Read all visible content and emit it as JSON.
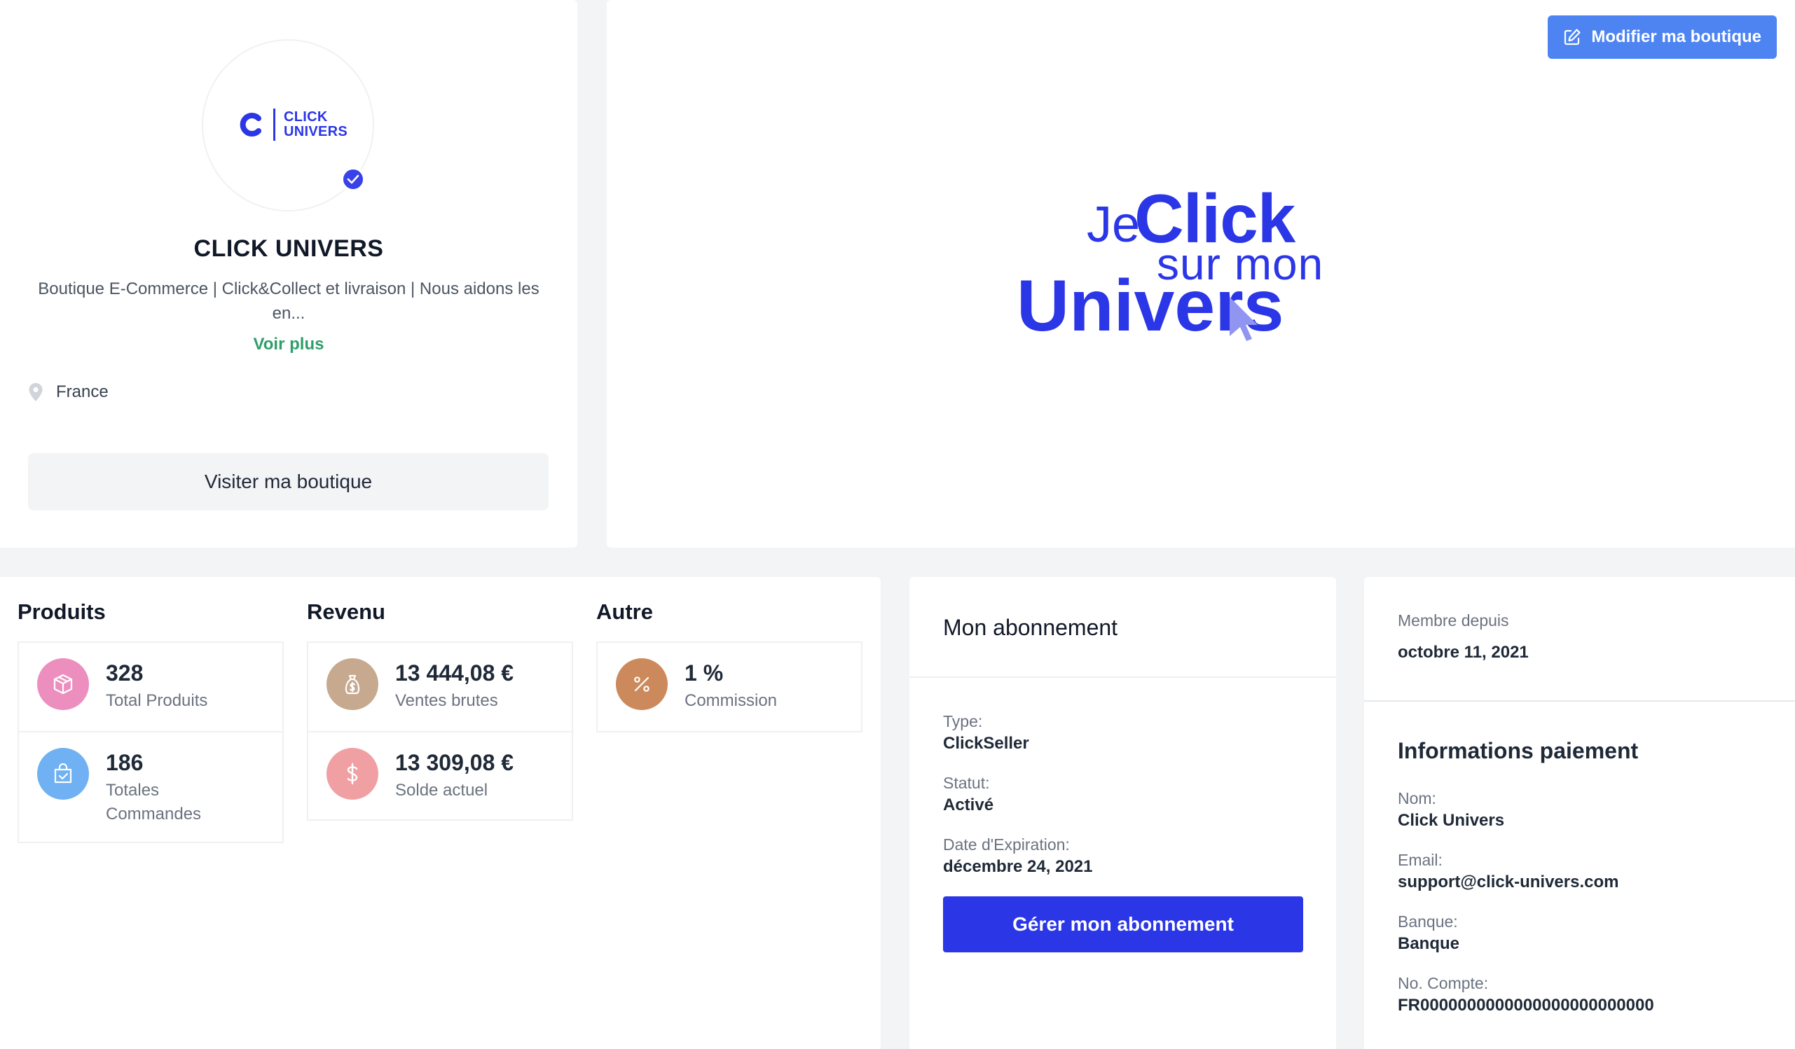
{
  "profile": {
    "logo_line1": "CLICK",
    "logo_line2": "UNIVERS",
    "shop_name": "CLICK UNIVERS",
    "description": "Boutique E-Commerce | Click&Collect et livraison | Nous aidons les en...",
    "voir_plus": "Voir plus",
    "location": "France",
    "visit_button": "Visiter ma boutique"
  },
  "banner": {
    "edit_button": "Modifier ma boutique",
    "art_je": "Je",
    "art_click": "Click",
    "art_sur_mon": "sur mon",
    "art_univers": "Univers"
  },
  "stats": {
    "produits": {
      "heading": "Produits",
      "rows": [
        {
          "value": "328",
          "label": "Total Produits",
          "icon": "box-icon",
          "color": "#ec8fbf"
        },
        {
          "value": "186",
          "label": "Totales Commandes",
          "icon": "shopping-bag-icon",
          "color": "#6fb1f2"
        }
      ]
    },
    "revenu": {
      "heading": "Revenu",
      "rows": [
        {
          "value": "13 444,08 €",
          "label": "Ventes brutes",
          "icon": "money-bag-icon",
          "color": "#c7a98f"
        },
        {
          "value": "13 309,08 €",
          "label": "Solde actuel",
          "icon": "dollar-icon",
          "color": "#f0a0a2"
        }
      ]
    },
    "autre": {
      "heading": "Autre",
      "rows": [
        {
          "value": "1 %",
          "label": "Commission",
          "icon": "percent-icon",
          "color": "#cc8a5c"
        }
      ]
    }
  },
  "subscription": {
    "title": "Mon abonnement",
    "type_label": "Type:",
    "type_value": "ClickSeller",
    "status_label": "Statut:",
    "status_value": "Activé",
    "expiry_label": "Date d'Expiration:",
    "expiry_value": "décembre 24, 2021",
    "manage_button": "Gérer mon abonnement"
  },
  "member": {
    "since_label": "Membre depuis",
    "since_value": "octobre 11, 2021",
    "payment_title": "Informations paiement",
    "name_label": "Nom:",
    "name_value": "Click Univers",
    "email_label": "Email:",
    "email_value": "support@click-univers.com",
    "bank_label": "Banque:",
    "bank_value": "Banque",
    "account_label": "No. Compte:",
    "account_value": "FR0000000000000000000000000"
  },
  "colors": {
    "brand_blue": "#2b36e6",
    "edit_button": "#4d84f2",
    "voir_plus_green": "#2f9e6a"
  }
}
